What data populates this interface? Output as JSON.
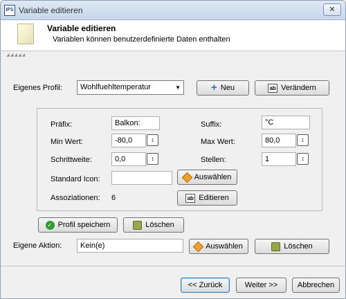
{
  "window": {
    "title": "Variable editieren",
    "app_icon_text": "IPS",
    "close_symbol": "✕"
  },
  "header": {
    "title": "Variable editieren",
    "subtitle": "Variablen können benutzerdefinierte Daten enthalten"
  },
  "profile": {
    "label": "Eigenes Profil:",
    "selected": "Wohlfuehltemperatur",
    "new_label": "Neu",
    "change_label": "Verändern"
  },
  "details": {
    "prefix_label": "Präfix:",
    "prefix_value": "Balkon:",
    "suffix_label": "Suffix:",
    "suffix_value": "°C",
    "min_label": "Min Wert:",
    "min_value": "-80,0",
    "max_label": "Max Wert:",
    "max_value": "80,0",
    "step_label": "Schrittweite:",
    "step_value": "0,0",
    "digits_label": "Stellen:",
    "digits_value": "1",
    "icon_label": "Standard Icon:",
    "icon_value": "",
    "select_label": "Auswählen",
    "assoc_label": "Assoziationen:",
    "assoc_count": "6",
    "edit_label": "Editieren"
  },
  "profile_actions": {
    "save_label": "Profil speichern",
    "delete_label": "Löschen"
  },
  "action": {
    "label": "Eigene Aktion:",
    "value": "Kein(e)",
    "select_label": "Auswählen",
    "delete_label": "Löschen"
  },
  "footer": {
    "back_label": "<< Zurück",
    "next_label": "Weiter >>",
    "cancel_label": "Abbrechen"
  },
  "icons": {
    "app": "ips-app-icon",
    "new": "plus-icon",
    "change": "ab-icon",
    "select": "diamond-icon",
    "save": "checkmark-icon",
    "delete": "trash-icon",
    "spin": "spinner-arrows-icon"
  },
  "colors": {
    "accent": "#2d73c4",
    "titlebar": "#c6d7ec",
    "dialog_bg": "#f0f0f0"
  }
}
